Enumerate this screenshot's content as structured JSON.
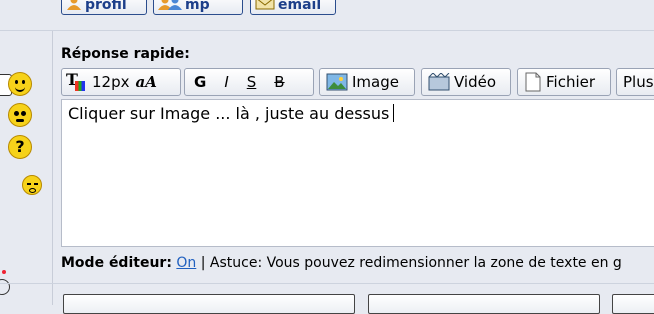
{
  "top_buttons": [
    {
      "label": "profil",
      "icon": "user-icon"
    },
    {
      "label": "mp",
      "icon": "users-icon"
    },
    {
      "label": "email",
      "icon": "envelope-icon"
    }
  ],
  "reply": {
    "title": "Réponse rapide:",
    "font_size": "12px",
    "bold": "G",
    "italic": "I",
    "underline": "S",
    "strike": "B",
    "image_label": "Image",
    "video_label": "Vidéo",
    "file_label": "Fichier",
    "more_label": "Plus",
    "editor_text": "Cliquer sur Image ... là , juste au dessus",
    "mode_label": "Mode éditeur:",
    "mode_value": "On",
    "tip": "| Astuce: Vous pouvez redimensionner la zone de texte en g"
  },
  "colors": {
    "accent": "#1f5fbf",
    "background": "#e7eaf1",
    "smiley": "#f6d21a"
  }
}
